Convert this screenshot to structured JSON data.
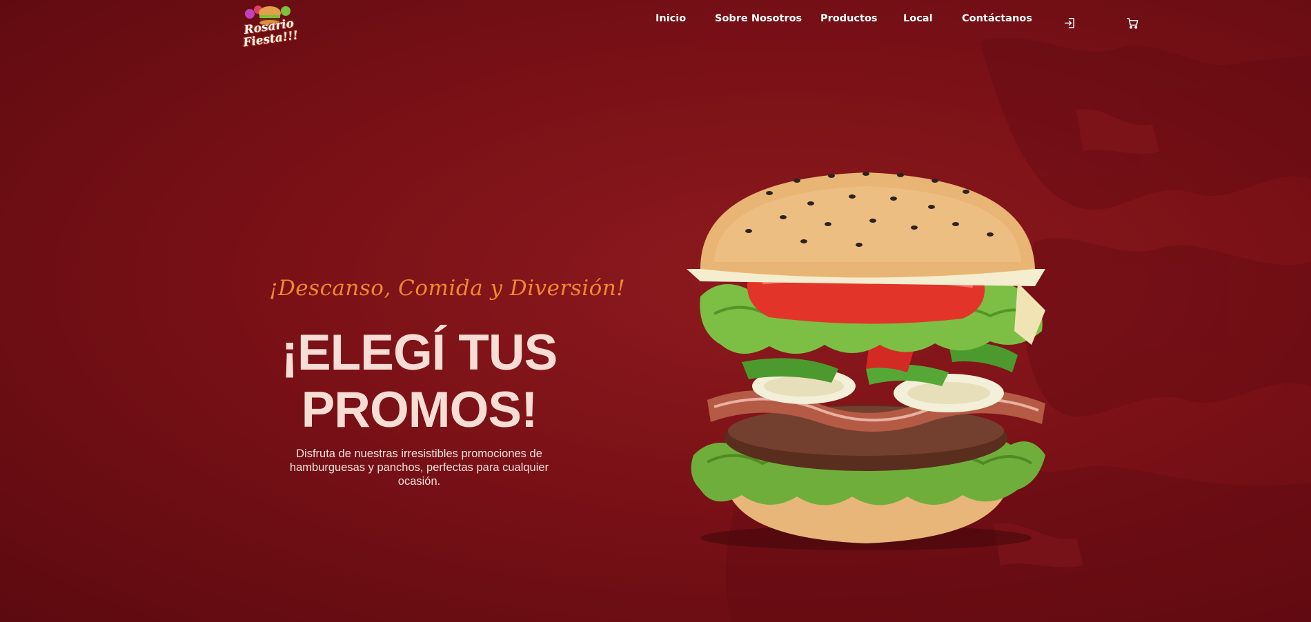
{
  "brand": {
    "logo_line1": "Rosario",
    "logo_line2": "Fiesta!!!"
  },
  "nav": {
    "items": [
      {
        "label": "Inicio"
      },
      {
        "label": "Sobre Nosotros"
      },
      {
        "label": "Productos"
      },
      {
        "label": "Local"
      },
      {
        "label": "Contáctanos"
      }
    ],
    "login_icon": "login-icon",
    "cart_icon": "cart-icon"
  },
  "hero": {
    "tagline": "¡Descanso, Comida y Diversión!",
    "headline": "¡ELEGÍ TUS PROMOS!",
    "description": "Disfruta de nuestras irresistibles promociones de hamburguesas y panchos, perfectas para cualquier ocasión.",
    "image": "burger-image"
  },
  "colors": {
    "background": "#7a1117",
    "tagline": "#f1882f",
    "headline": "#f7ddd3",
    "nav_text": "#ffffff"
  }
}
